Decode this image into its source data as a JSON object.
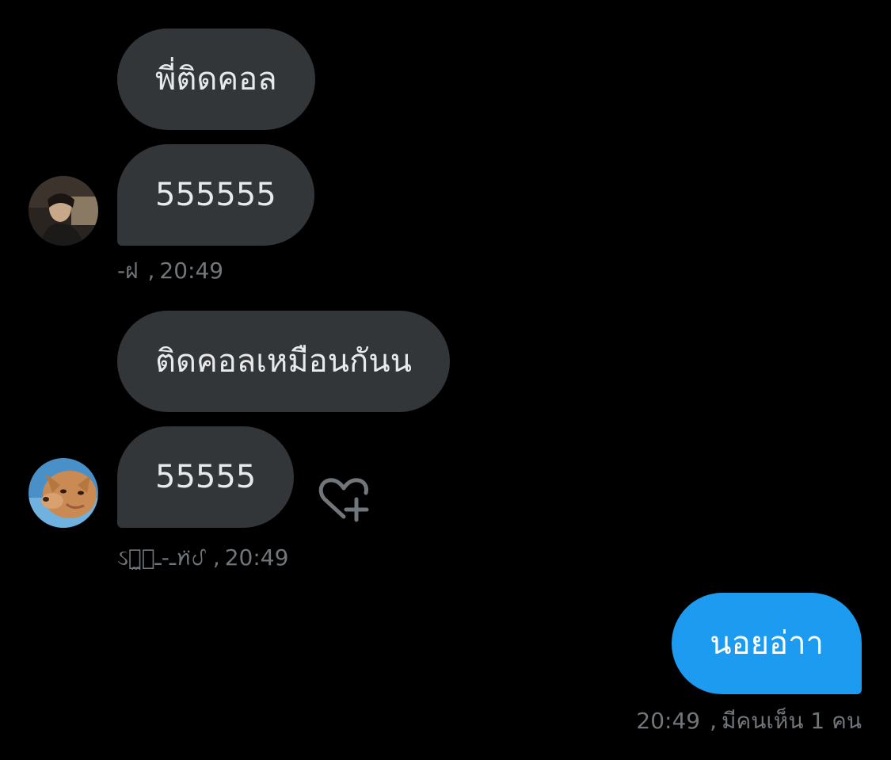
{
  "colors": {
    "background": "#000000",
    "incoming_bubble": "#333639",
    "outgoing_bubble": "#1d9bf0",
    "meta_text": "#71767b"
  },
  "conversation": {
    "group1": {
      "messages": [
        "พี่ติดคอล",
        "555555"
      ],
      "sender": "-ฝ",
      "time": "20:49",
      "avatar_icon": "user-photo-avatar"
    },
    "group2": {
      "messages": [
        "ติดคอลเหมือนกันน",
        "55555"
      ],
      "sender": "ઽꪮ̼ـ-ـ͙ꪀ̈ᦔ",
      "time": "20:49",
      "avatar_icon": "dog-photo-avatar",
      "reaction_icon": "heart-plus-icon"
    },
    "outgoing": {
      "message": "นอยอ่าา",
      "time": "20:49",
      "seen_text": "มีคนเห็น 1 คน"
    }
  }
}
